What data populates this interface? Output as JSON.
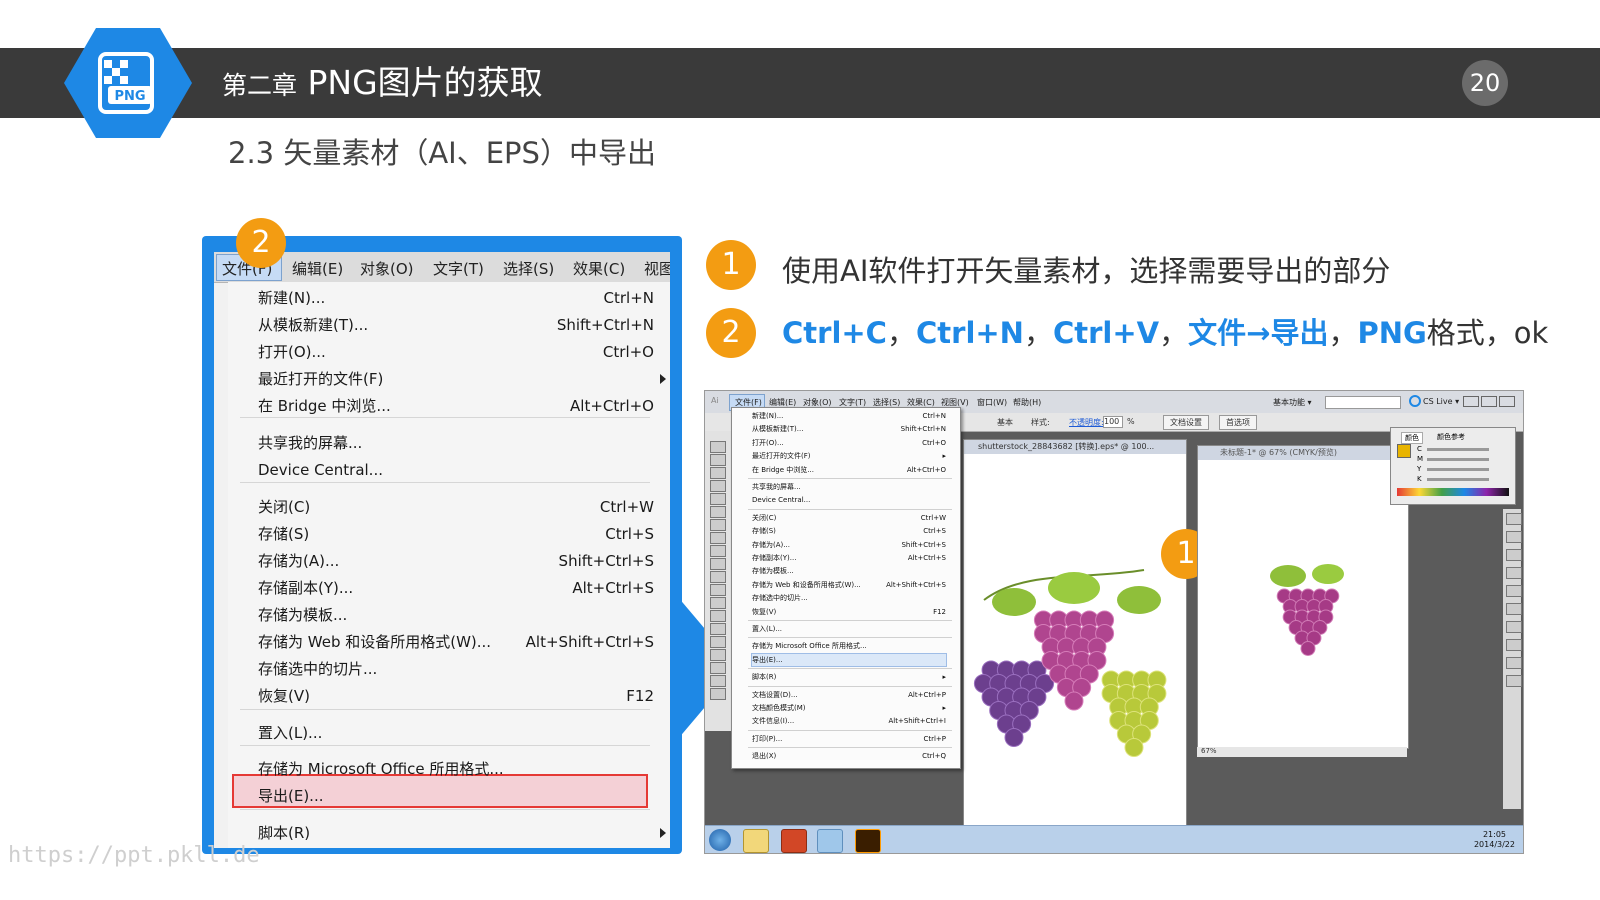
{
  "header": {
    "logo_text": "PNG",
    "chapter_label": "第二章",
    "chapter_title": "PNG图片的获取",
    "page_number": "20"
  },
  "section_title": "2.3 矢量素材（AI、EPS）中导出",
  "steps": [
    {
      "badge": "1",
      "text": "使用AI软件打开矢量素材，选择需要导出的部分"
    },
    {
      "badge": "2",
      "parts": [
        "Ctrl+C",
        "，",
        "Ctrl+N",
        "，",
        "Ctrl+V",
        "，",
        "文件→导出",
        "，",
        "PNG",
        "格式，ok"
      ]
    }
  ],
  "menu_callout_badge": "2",
  "image_callout_badge": "1",
  "menu": {
    "bar": [
      "文件(F)",
      "编辑(E)",
      "对象(O)",
      "文字(T)",
      "选择(S)",
      "效果(C)",
      "视图"
    ],
    "items": [
      {
        "label": "新建(N)...",
        "shortcut": "Ctrl+N"
      },
      {
        "label": "从模板新建(T)...",
        "shortcut": "Shift+Ctrl+N"
      },
      {
        "label": "打开(O)...",
        "shortcut": "Ctrl+O"
      },
      {
        "label": "最近打开的文件(F)",
        "shortcut": ""
      },
      {
        "label": "在 Bridge 中浏览...",
        "shortcut": "Alt+Ctrl+O"
      },
      {
        "label": "共享我的屏幕...",
        "shortcut": ""
      },
      {
        "label": "Device Central...",
        "shortcut": ""
      },
      {
        "label": "关闭(C)",
        "shortcut": "Ctrl+W"
      },
      {
        "label": "存储(S)",
        "shortcut": "Ctrl+S"
      },
      {
        "label": "存储为(A)...",
        "shortcut": "Shift+Ctrl+S"
      },
      {
        "label": "存储副本(Y)...",
        "shortcut": "Alt+Ctrl+S"
      },
      {
        "label": "存储为模板...",
        "shortcut": ""
      },
      {
        "label": "存储为 Web 和设备所用格式(W)...",
        "shortcut": "Alt+Shift+Ctrl+S"
      },
      {
        "label": "存储选中的切片...",
        "shortcut": ""
      },
      {
        "label": "恢复(V)",
        "shortcut": "F12"
      },
      {
        "label": "置入(L)...",
        "shortcut": ""
      },
      {
        "label": "存储为 Microsoft Office 所用格式...",
        "shortcut": ""
      },
      {
        "label": "导出(E)...",
        "shortcut": ""
      },
      {
        "label": "脚本(R)",
        "shortcut": ""
      }
    ]
  },
  "ai_window": {
    "menubar": [
      "文件(F)",
      "编辑(E)",
      "对象(O)",
      "文字(T)",
      "选择(S)",
      "效果(C)",
      "视图(V)",
      "窗口(W)",
      "帮助(H)"
    ],
    "workspace": "基本功能 ▾",
    "cs_live": "CS Live ▾",
    "ctrl_text": [
      "基本",
      "样式:",
      "不透明度:",
      "100",
      "%",
      "文档设置",
      "首选项"
    ],
    "doc1_tab": "shutterstock_28843682 [转换].eps* @ 100...",
    "doc2_tab": "未标题-1* @ 67% (CMYK/预览)",
    "doc2_zoom": "67%",
    "color_panel_tabs": [
      "颜色",
      "颜色参考"
    ],
    "color_channels": [
      "C",
      "M",
      "Y",
      "K"
    ],
    "clock_time": "21:05",
    "clock_date": "2014/3/22",
    "file_menu": [
      {
        "label": "新建(N)...",
        "shortcut": "Ctrl+N"
      },
      {
        "label": "从模板新建(T)...",
        "shortcut": "Shift+Ctrl+N"
      },
      {
        "label": "打开(O)...",
        "shortcut": "Ctrl+O"
      },
      {
        "label": "最近打开的文件(F)",
        "shortcut": "▸"
      },
      {
        "label": "在 Bridge 中浏览...",
        "shortcut": "Alt+Ctrl+O"
      },
      {
        "label": "共享我的屏幕...",
        "shortcut": ""
      },
      {
        "label": "Device Central...",
        "shortcut": ""
      },
      {
        "label": "关闭(C)",
        "shortcut": "Ctrl+W"
      },
      {
        "label": "存储(S)",
        "shortcut": "Ctrl+S"
      },
      {
        "label": "存储为(A)...",
        "shortcut": "Shift+Ctrl+S"
      },
      {
        "label": "存储副本(Y)...",
        "shortcut": "Alt+Ctrl+S"
      },
      {
        "label": "存储为模板...",
        "shortcut": ""
      },
      {
        "label": "存储为 Web 和设备所用格式(W)...",
        "shortcut": "Alt+Shift+Ctrl+S"
      },
      {
        "label": "存储选中的切片...",
        "shortcut": ""
      },
      {
        "label": "恢复(V)",
        "shortcut": "F12"
      },
      {
        "label": "置入(L)...",
        "shortcut": ""
      },
      {
        "label": "存储为 Microsoft Office 所用格式...",
        "shortcut": ""
      },
      {
        "label": "导出(E)...",
        "shortcut": ""
      },
      {
        "label": "脚本(R)",
        "shortcut": "▸"
      },
      {
        "label": "文档设置(D)...",
        "shortcut": "Alt+Ctrl+P"
      },
      {
        "label": "文档颜色模式(M)",
        "shortcut": "▸"
      },
      {
        "label": "文件信息(I)...",
        "shortcut": "Alt+Shift+Ctrl+I"
      },
      {
        "label": "打印(P)...",
        "shortcut": "Ctrl+P"
      },
      {
        "label": "退出(X)",
        "shortcut": "Ctrl+Q"
      }
    ]
  },
  "watermark": "https://ppt.pkll.de",
  "colors": {
    "accent_blue": "#1e88e5",
    "badge_orange": "#f39c12",
    "header_dark": "#3a3a3a"
  }
}
